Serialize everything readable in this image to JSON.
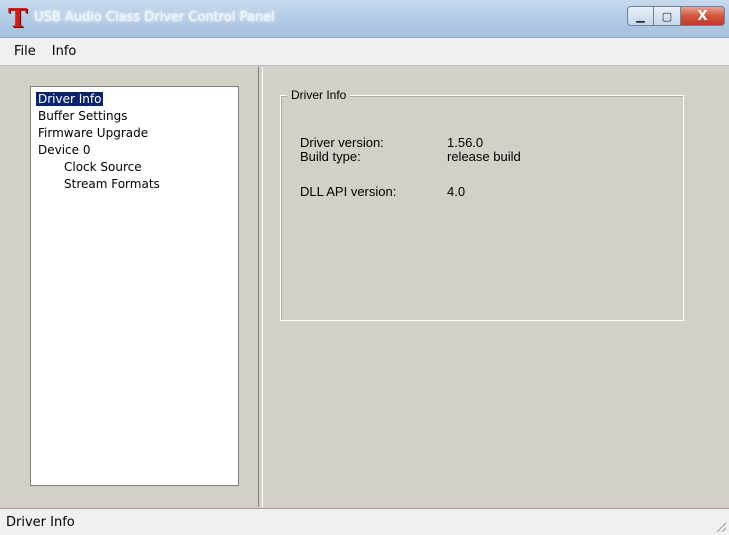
{
  "window": {
    "title": "USB Audio Class Driver Control Panel",
    "logo_letter": "T",
    "minimize_glyph": "▁",
    "maximize_glyph": "▢",
    "close_glyph": "X"
  },
  "menu": [
    "File",
    "Info"
  ],
  "tree": {
    "items": [
      {
        "label": "Driver Info",
        "level": 0,
        "selected": true
      },
      {
        "label": "Buffer Settings",
        "level": 0,
        "selected": false
      },
      {
        "label": "Firmware Upgrade",
        "level": 0,
        "selected": false
      },
      {
        "label": "Device 0",
        "level": 0,
        "selected": false
      },
      {
        "label": "Clock Source",
        "level": 1,
        "selected": false
      },
      {
        "label": "Stream Formats",
        "level": 1,
        "selected": false
      }
    ]
  },
  "driver_info": {
    "group_title": "Driver Info",
    "rows": [
      {
        "label": "Driver version:",
        "value": "1.56.0"
      },
      {
        "label": "Build type:",
        "value": "release build"
      },
      {
        "label": "DLL API version:",
        "value": "4.0"
      }
    ]
  },
  "status": {
    "text": "Driver Info"
  }
}
